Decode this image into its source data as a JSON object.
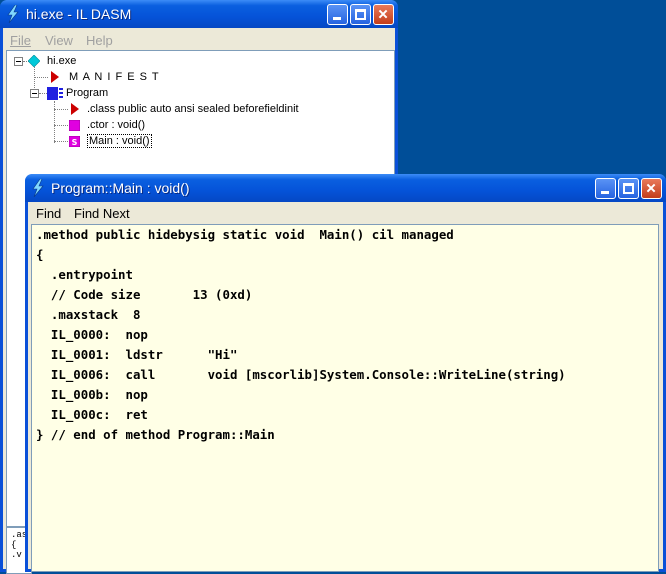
{
  "back_window": {
    "title": "hi.exe - IL DASM",
    "menu": [
      "File",
      "View",
      "Help"
    ],
    "tree": {
      "root": "hi.exe",
      "manifest": "M A N I F E S T",
      "program": "Program",
      "class_decl": ".class public auto ansi sealed beforefieldinit",
      "ctor": ".ctor : void()",
      "main": "Main : void()"
    },
    "bottom_lines": [
      ".as",
      "{",
      ".v"
    ]
  },
  "front_window": {
    "title": "Program::Main : void()",
    "menu": [
      "Find",
      "Find Next"
    ],
    "code_lines": [
      ".method public hidebysig static void  Main() cil managed",
      "{",
      "  .entrypoint",
      "  // Code size       13 (0xd)",
      "  .maxstack  8",
      "  IL_0000:  nop",
      "  IL_0001:  ldstr      \"Hi\"",
      "  IL_0006:  call       void [mscorlib]System.Console::WriteLine(string)",
      "  IL_000b:  nop",
      "  IL_000c:  ret",
      "} // end of method Program::Main"
    ]
  },
  "colors": {
    "desktop": "#004e98",
    "titlebar": "#0553d8",
    "code_background": "#ffffe6",
    "manifest_marker": "#cc0000",
    "class_marker": "#2020e0",
    "method_marker": "#e000e0",
    "root_marker": "#00c8d8"
  },
  "icons": {
    "app": "ildasm-lightning-icon",
    "root": "diamond-icon",
    "manifest": "triangle-right-icon",
    "class": "class-block-icon",
    "method": "method-square-icon",
    "static_method": "static-method-icon"
  }
}
